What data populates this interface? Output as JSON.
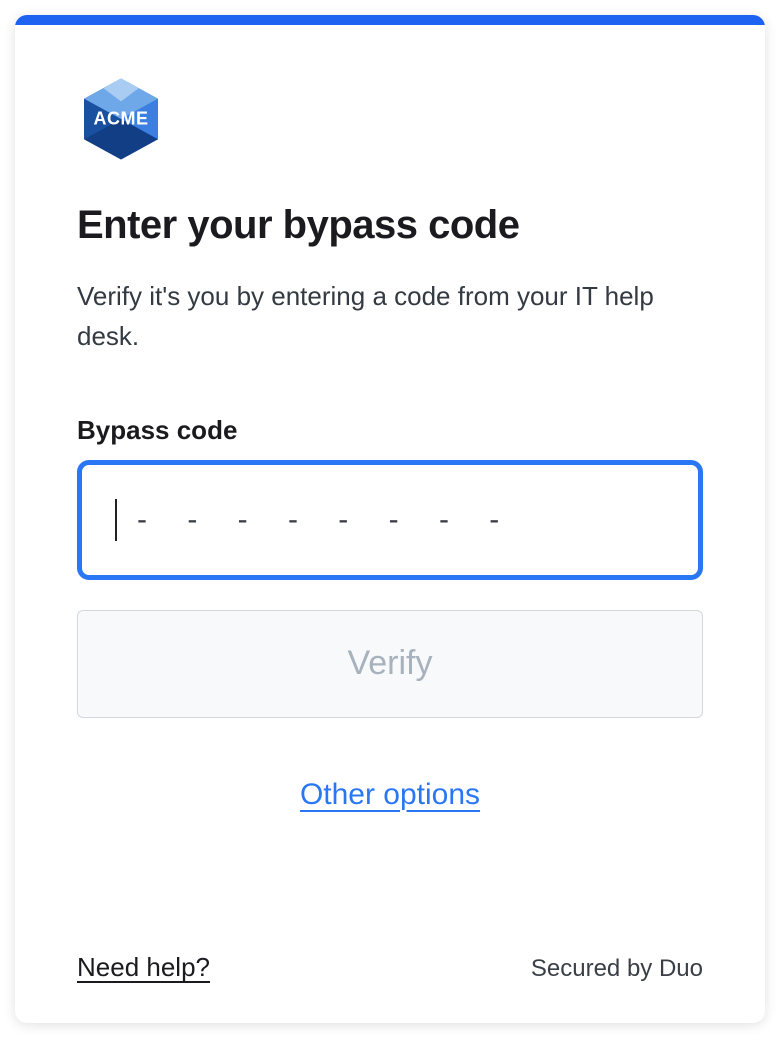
{
  "brand": {
    "logo_text": "ACME",
    "accent_color": "#1d62f0"
  },
  "header": {
    "title": "Enter your bypass code",
    "subtitle": "Verify it's you by entering a code from your IT help desk."
  },
  "form": {
    "field_label": "Bypass code",
    "input_value": "",
    "input_placeholder_visual": "- - - - - - - -",
    "verify_button_label": "Verify",
    "verify_button_disabled": true
  },
  "links": {
    "other_options": "Other options",
    "need_help": "Need help?"
  },
  "footer": {
    "secured_by": "Secured by Duo"
  }
}
